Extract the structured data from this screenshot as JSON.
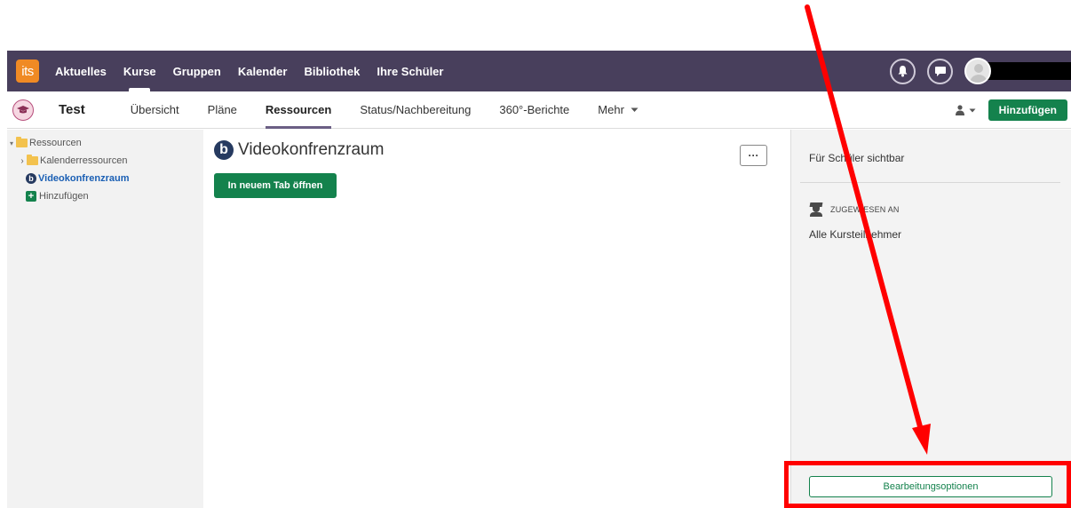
{
  "topnav": {
    "logo_text": "its",
    "items": [
      {
        "label": "Aktuelles"
      },
      {
        "label": "Kurse"
      },
      {
        "label": "Gruppen"
      },
      {
        "label": "Kalender"
      },
      {
        "label": "Bibliothek"
      },
      {
        "label": "Ihre Schüler"
      }
    ],
    "active_index": 1,
    "icons": [
      "bell-icon",
      "chat-icon",
      "avatar-icon"
    ],
    "bg_color": "#483f5c",
    "logo_color": "#f08a24"
  },
  "subnav": {
    "course_title": "Test",
    "items": [
      {
        "label": "Übersicht"
      },
      {
        "label": "Pläne"
      },
      {
        "label": "Ressourcen"
      },
      {
        "label": "Status/Nachbereitung"
      },
      {
        "label": "360°-Berichte"
      },
      {
        "label": "Mehr"
      }
    ],
    "active_index": 2,
    "add_button": "Hinzufügen",
    "accent_color": "#14824d"
  },
  "tree": {
    "root": "Ressourcen",
    "items": [
      {
        "label": "Kalenderressourcen"
      },
      {
        "label": "Videokonfrenzraum"
      },
      {
        "label": "Hinzufügen"
      }
    ]
  },
  "main": {
    "title": "Videokonfrenzraum",
    "open_button": "In neuem Tab öffnen",
    "more_button": "···"
  },
  "sidebar": {
    "visibility": "Für Schüler sichtbar",
    "assigned_label": "ZUGEWIESEN AN",
    "assigned_value": "Alle Kursteilnehmer",
    "edit_button": "Bearbeitungsoptionen"
  },
  "annotation": {
    "color": "#ff0000"
  }
}
